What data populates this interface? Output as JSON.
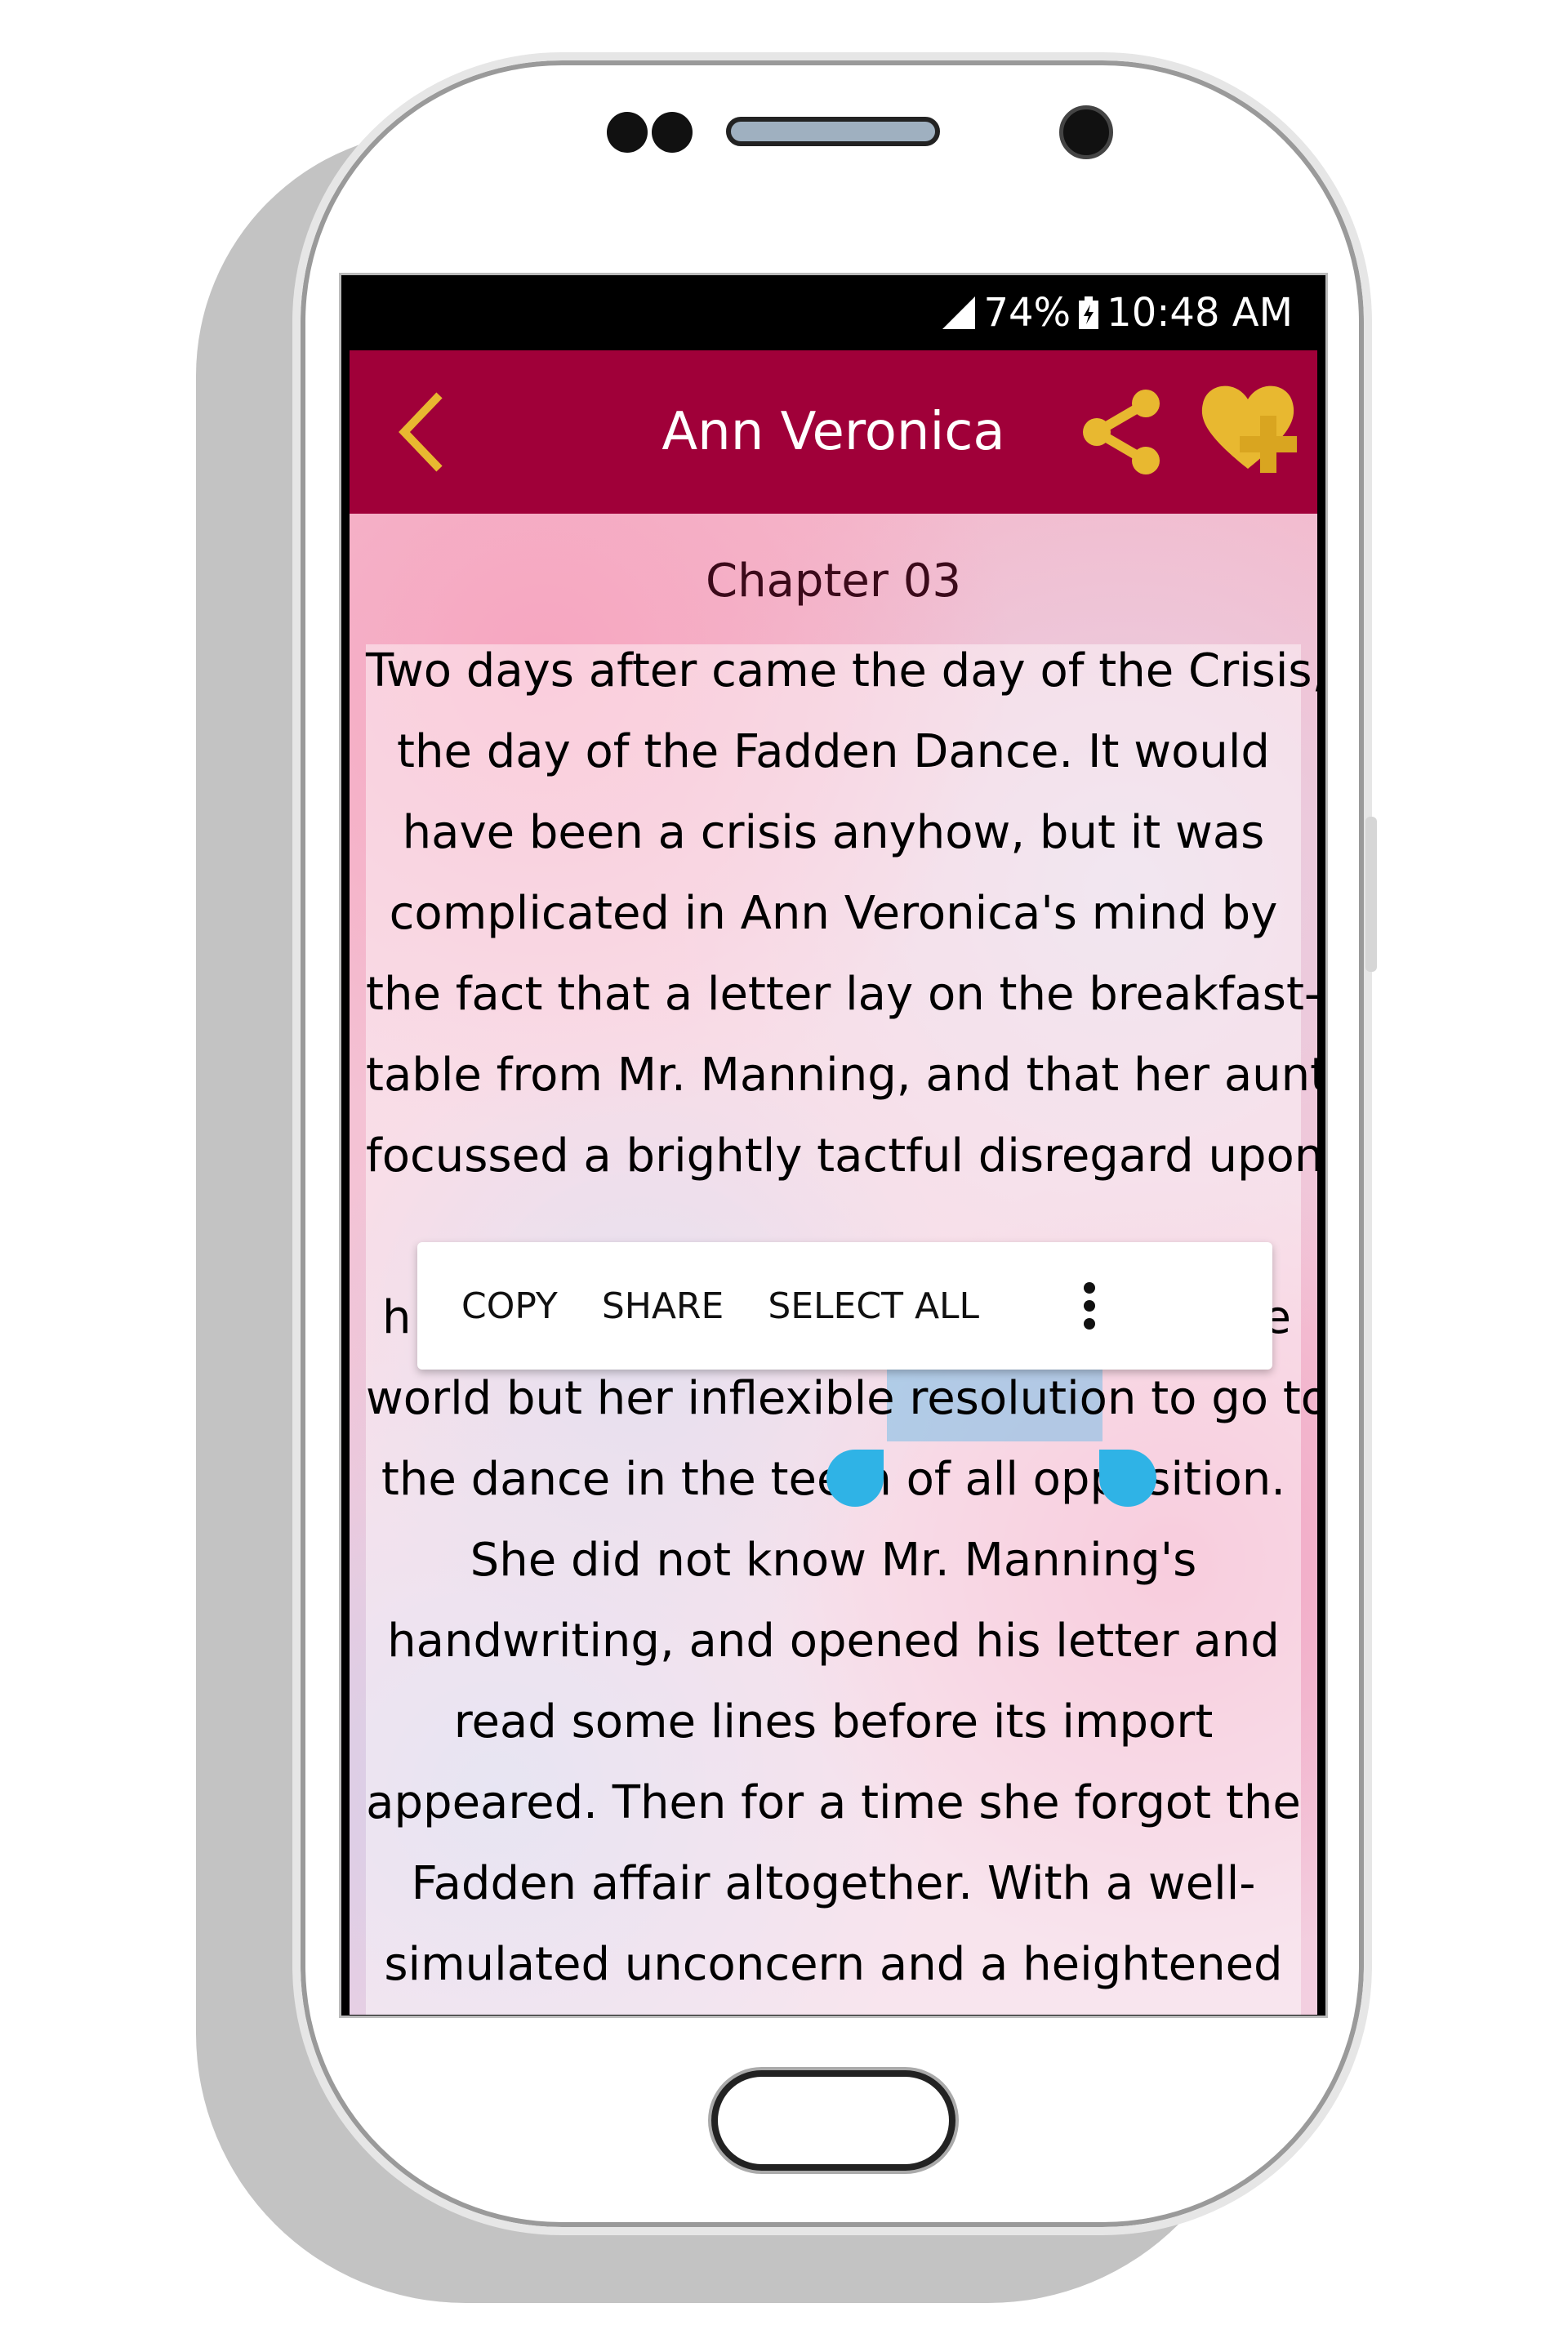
{
  "status_bar": {
    "battery": "74%",
    "time": "10:48 AM",
    "icons": [
      "signal-icon",
      "battery-charging-icon"
    ]
  },
  "app_bar": {
    "title": "Ann Veronica",
    "back_icon": "chevron-left-icon",
    "share_icon": "share-icon",
    "favorite_icon": "heart-plus-icon",
    "color": "#a00039",
    "icon_color": "#e8b830"
  },
  "content": {
    "chapter": "Chapter 03",
    "lines": [
      "Two days after came the day of the Crisis,",
      "the day of the Fadden Dance. It would",
      "have been a crisis anyhow, but it was",
      "complicated in Ann Veronica's mind by",
      "the fact that a letter lay on the breakfast-",
      "table from Mr. Manning, and that her aunt",
      "focussed a brightly tactful disregard upon"
    ],
    "partial_left": "h",
    "partial_right": "e",
    "lines_after": [
      "world but her inflexible resolution to go to",
      "the dance in the teeth of all opposition.",
      "She did not know Mr. Manning's",
      "handwriting, and opened his letter and",
      "read some lines before its import",
      "appeared. Then for a time she forgot the",
      "Fadden affair altogether. With a well-",
      "simulated unconcern and a heightened"
    ],
    "selected_text": "resolution"
  },
  "selection_menu": {
    "copy": "COPY",
    "share": "SHARE",
    "select_all": "SELECT ALL",
    "more_icon": "more-vert-icon",
    "selection_color": "#2fb3e6"
  }
}
